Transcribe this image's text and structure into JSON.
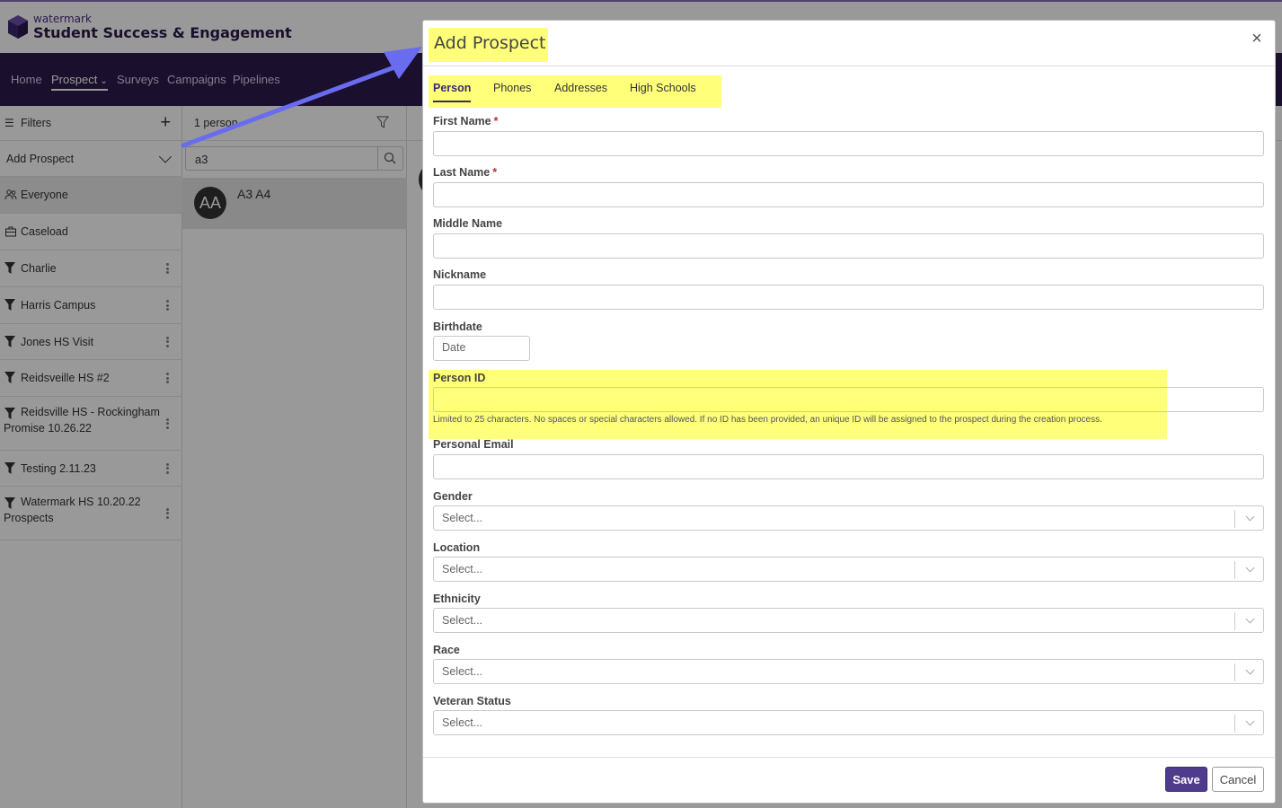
{
  "brand": {
    "company": "watermark",
    "product": "Student Success & Engagement"
  },
  "nav": {
    "items": [
      "Home",
      "Prospect",
      "Surveys",
      "Campaigns",
      "Pipelines"
    ],
    "active": "Prospect"
  },
  "sidebar": {
    "filters_label": "Filters",
    "add_prospect_label": "Add Prospect",
    "items": [
      {
        "label": "Everyone",
        "icon": "people-icon"
      },
      {
        "label": "Caseload",
        "icon": "briefcase-icon"
      },
      {
        "label": "Charlie",
        "icon": "filter-icon"
      },
      {
        "label": "Harris Campus",
        "icon": "filter-icon"
      },
      {
        "label": "Jones HS Visit",
        "icon": "filter-icon"
      },
      {
        "label": "Reidsveille HS #2",
        "icon": "filter-icon"
      },
      {
        "label": "Reidsville HS - Rockingham Promise 10.26.22",
        "icon": "filter-icon"
      },
      {
        "label": "Testing 2.11.23",
        "icon": "filter-icon"
      },
      {
        "label": "Watermark HS 10.20.22 Prospects",
        "icon": "filter-icon"
      }
    ]
  },
  "list": {
    "count_label": "1 person",
    "search_value": "a3",
    "person": {
      "initials": "AA",
      "name": "A3 A4"
    }
  },
  "modal": {
    "title": "Add Prospect",
    "tabs": [
      "Person",
      "Phones",
      "Addresses",
      "High Schools"
    ],
    "active_tab": "Person",
    "fields": {
      "first_name": "First Name",
      "last_name": "Last Name",
      "middle_name": "Middle Name",
      "nickname": "Nickname",
      "birthdate": "Birthdate",
      "birthdate_placeholder": "Date",
      "person_id": "Person ID",
      "person_id_help": "Limited to 25 characters. No spaces or special characters allowed. If no ID has been provided, an unique ID will be assigned to the prospect during the creation process.",
      "personal_email": "Personal Email",
      "gender": "Gender",
      "location": "Location",
      "ethnicity": "Ethnicity",
      "race": "Race",
      "veteran_status": "Veteran Status"
    },
    "required_mark": "*",
    "select_placeholder": "Select...",
    "save_label": "Save",
    "cancel_label": "Cancel"
  },
  "colors": {
    "nav_bg": "#2d1a4d",
    "primary": "#4e3b8c",
    "highlight": "#ffff7a",
    "arrow": "#6a6cf0",
    "required": "#c0302f"
  }
}
